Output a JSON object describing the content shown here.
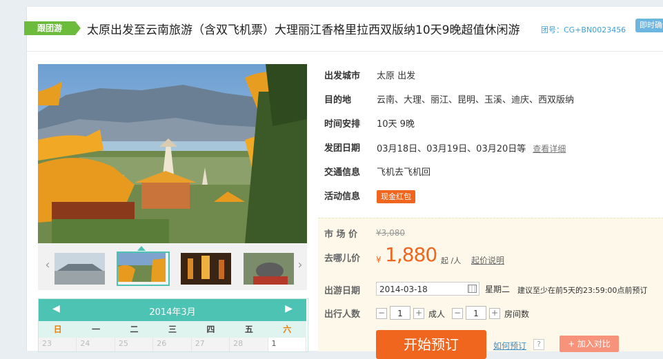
{
  "header": {
    "tag": "跟团游",
    "title": "太原出发至云南旅游（含双飞机票）大理丽江香格里拉西双版纳10天9晚超值休闲游",
    "group_no": "团号：CG+BN0023456",
    "instant_badge": "即时确认"
  },
  "info": {
    "departure_label": "出发城市",
    "departure_value": "太原 出发",
    "destination_label": "目的地",
    "destination_value": "云南、大理、丽江、昆明、玉溪、迪庆、西双版纳",
    "duration_label": "时间安排",
    "duration_value": "10天 9晚",
    "dates_label": "发团日期",
    "dates_value": "03月18日、03月19日、03月20日等",
    "dates_more": "查看详细",
    "transport_label": "交通信息",
    "transport_value": "飞机去飞机回",
    "promo_label": "活动信息",
    "promo_badge": "现金红包"
  },
  "price": {
    "market_label": "市 场 价",
    "market_value": "¥3,080",
    "qunar_label": "去哪儿价",
    "currency": "¥",
    "value": "1,880",
    "unit": "起 /人",
    "explain": "起价说明"
  },
  "booking": {
    "date_label": "出游日期",
    "date_value": "2014-03-18",
    "weekday": "星期二",
    "advise": "建议至少在前5天的23:59:00点前预订",
    "people_label": "出行人数",
    "minus": "−",
    "plus": "+",
    "adults": "1",
    "adults_label": "成人",
    "rooms": "1",
    "rooms_label": "房间数",
    "book_button": "开始预订",
    "how_to_book": "如何预订",
    "question": "?",
    "compare_button": "+ 加入对比"
  },
  "gallery": {
    "prev": "‹",
    "next": "›",
    "thumbs": [
      "airport-photo",
      "pagoda-photo",
      "night-street-photo",
      "elephant-photo"
    ],
    "selected_index": 1
  },
  "calendar": {
    "title": "2014年3月",
    "prev": "◀",
    "next": "▶",
    "weekdays": [
      "日",
      "一",
      "二",
      "三",
      "四",
      "五",
      "六"
    ],
    "first_row": [
      "23",
      "24",
      "25",
      "26",
      "27",
      "28",
      "1"
    ]
  },
  "colors": {
    "accent": "#f0661e",
    "teal": "#4cc3b3",
    "tag_green": "#6cbb3c",
    "link_blue": "#3ea1d8"
  }
}
